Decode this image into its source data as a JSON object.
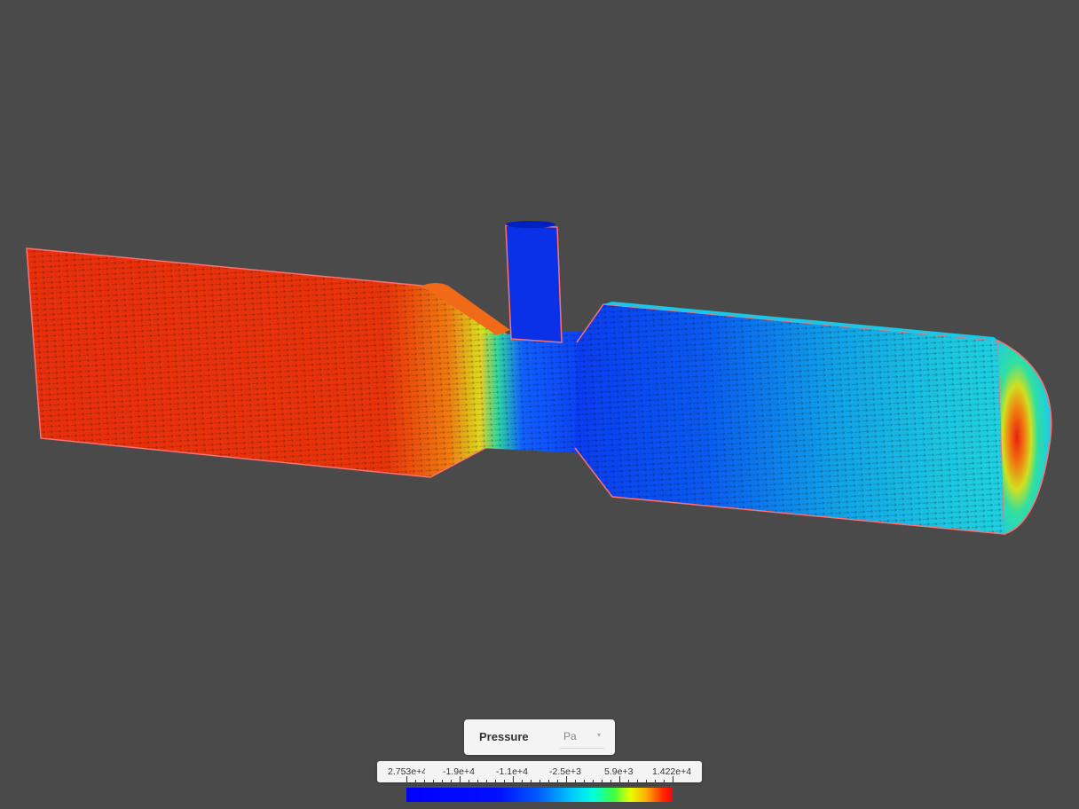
{
  "legend": {
    "title": "Pressure",
    "unit": "Pa",
    "ticks": [
      "2.753e+4",
      "-1.9e+4",
      "-1.1e+4",
      "-2.5e+3",
      "5.9e+3",
      "1.422e+4"
    ]
  },
  "colors": {
    "background": "#4a4a4a",
    "high_pressure": "#e8300c",
    "low_pressure": "#0a3cf0",
    "outline": "#ff7070"
  }
}
